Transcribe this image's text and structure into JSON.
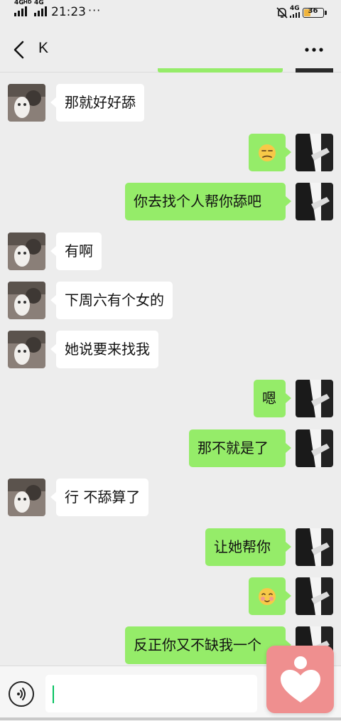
{
  "status_bar": {
    "signal_1_label": "4G",
    "signal_1_sub": "HD",
    "signal_2_label": "4G",
    "time": "21:23",
    "more": "···",
    "network_2_label": "4G",
    "battery_level": "36",
    "battery_fraction": 0.36
  },
  "header": {
    "title": "K",
    "back_icon": "chevron-left-icon",
    "menu_icon": "more-horizontal-icon"
  },
  "messages": [
    {
      "side": "left",
      "text": "那就好好舔"
    },
    {
      "side": "right",
      "emoji": "unamused-face-emoji"
    },
    {
      "side": "right",
      "text": "你去找个人帮你舔吧"
    },
    {
      "side": "left",
      "text": "有啊"
    },
    {
      "side": "left",
      "text": "下周六有个女的"
    },
    {
      "side": "left",
      "text": "她说要来找我"
    },
    {
      "side": "right",
      "text": "嗯"
    },
    {
      "side": "right",
      "text": "那不就是了"
    },
    {
      "side": "left",
      "text": "行 不舔算了"
    },
    {
      "side": "right",
      "text": "让她帮你"
    },
    {
      "side": "right",
      "emoji": "blushing-face-emoji"
    },
    {
      "side": "right",
      "text": "反正你又不缺我一个"
    }
  ],
  "input_bar": {
    "voice_icon": "voice-input-icon",
    "input_value": ""
  },
  "floating_app_icon": "heart-app-icon",
  "colors": {
    "background": "#ededed",
    "outgoing_bubble": "#95ec69",
    "incoming_bubble": "#ffffff",
    "battery": "#f0b43c",
    "floating_app": "#ef8f8f"
  }
}
